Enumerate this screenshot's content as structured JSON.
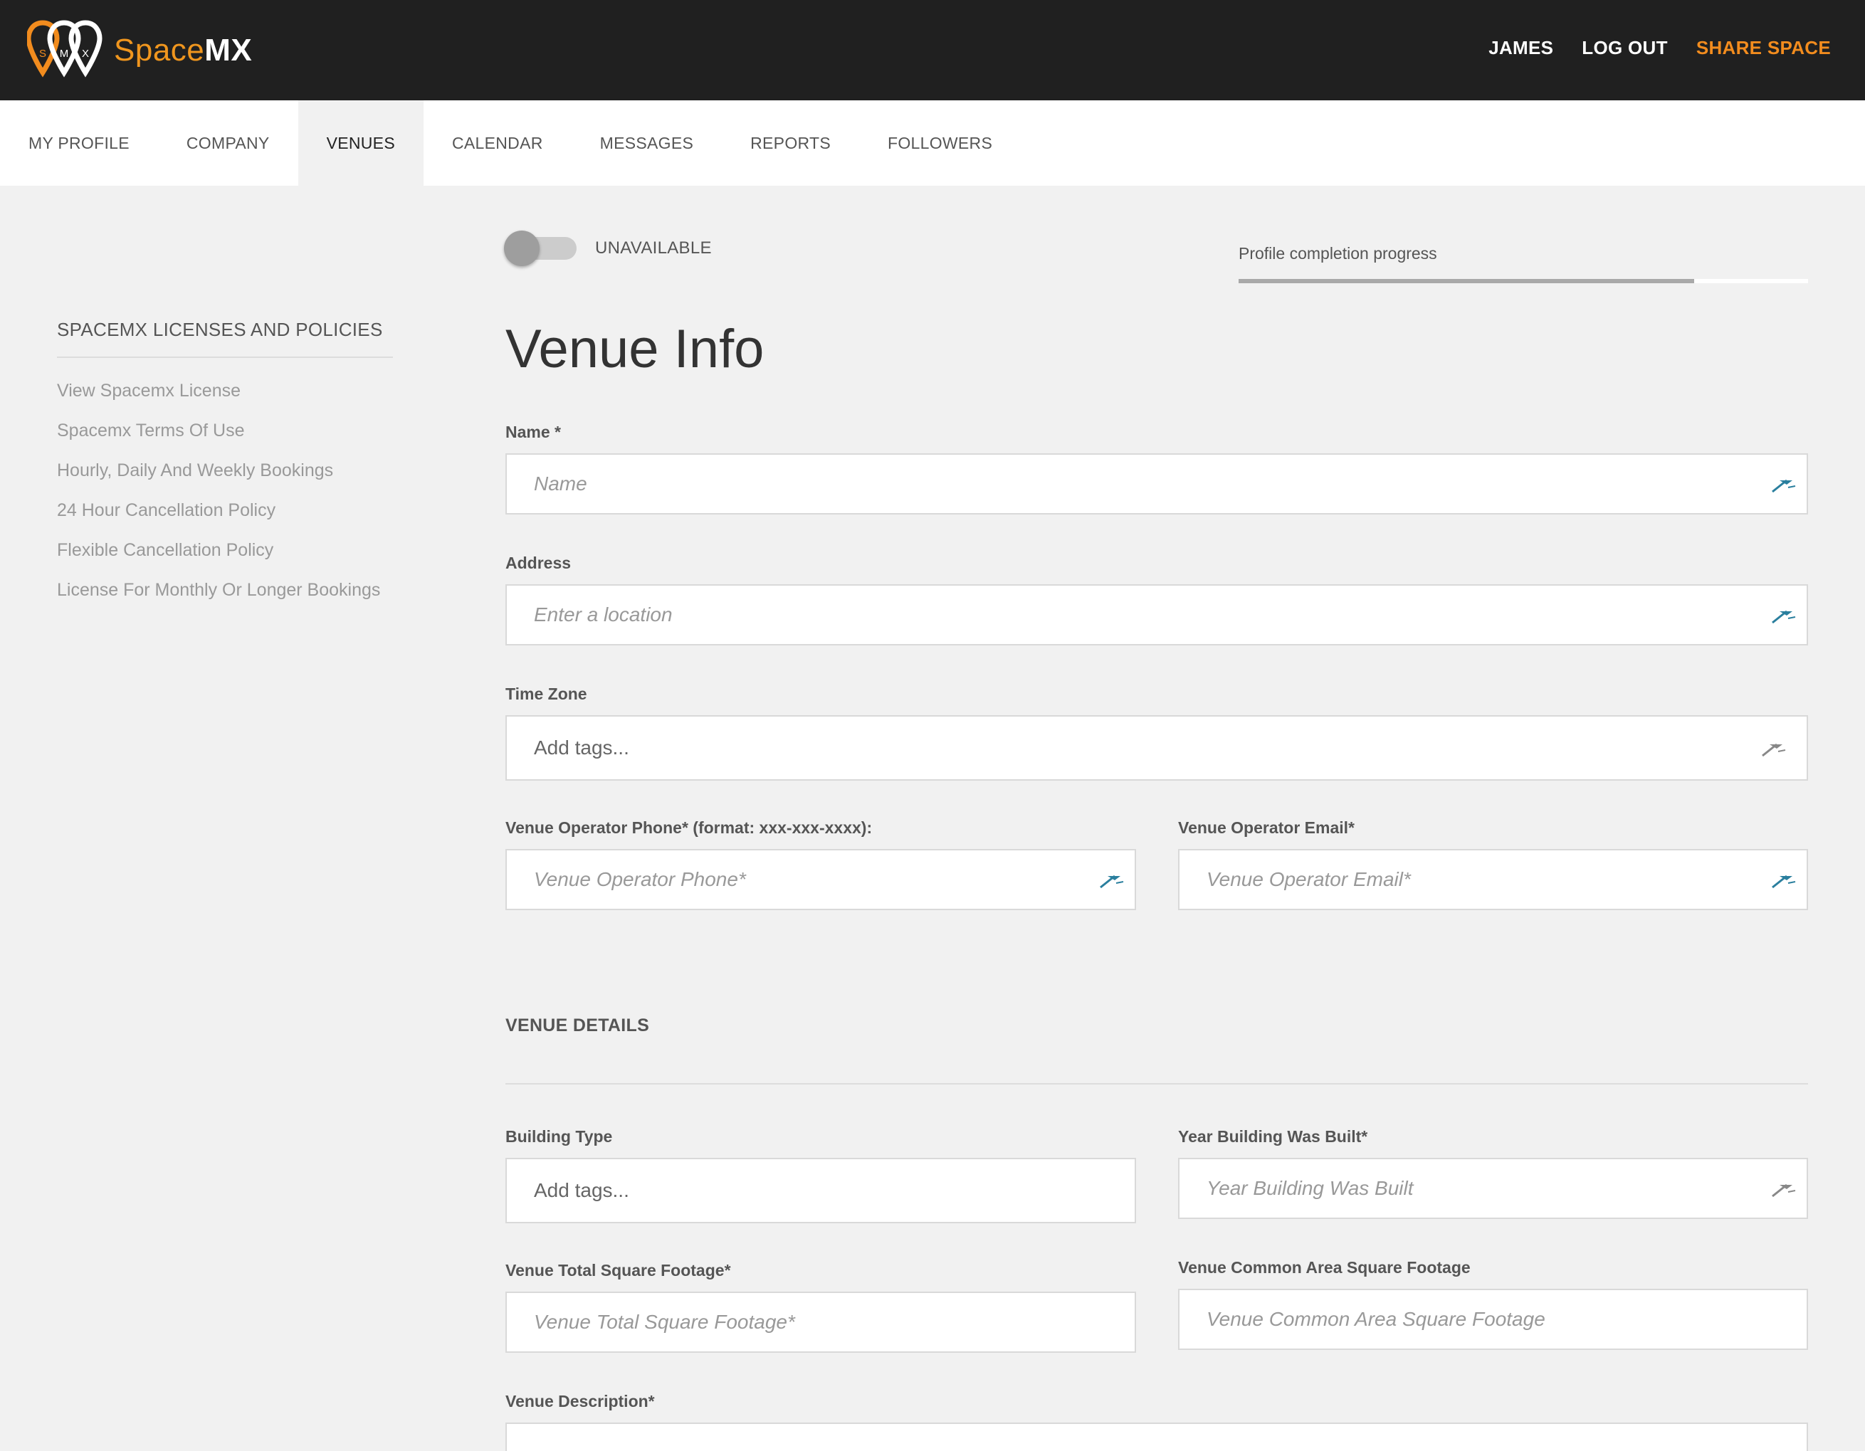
{
  "brand": {
    "space": "Space",
    "mx": "MX",
    "logo_letters": [
      "S",
      "M",
      "X"
    ],
    "accent_color": "#f28c1e"
  },
  "top_nav": {
    "user": "JAMES",
    "logout": "LOG OUT",
    "share": "SHARE SPACE"
  },
  "tabs": [
    {
      "label": "MY PROFILE",
      "active": false
    },
    {
      "label": "COMPANY",
      "active": false
    },
    {
      "label": "VENUES",
      "active": true
    },
    {
      "label": "CALENDAR",
      "active": false
    },
    {
      "label": "MESSAGES",
      "active": false
    },
    {
      "label": "REPORTS",
      "active": false
    },
    {
      "label": "FOLLOWERS",
      "active": false
    }
  ],
  "sidebar": {
    "title": "SPACEMX LICENSES AND POLICIES",
    "links": [
      "View Spacemx License",
      "Spacemx Terms Of Use",
      "Hourly, Daily And Weekly Bookings",
      "24 Hour Cancellation Policy",
      "Flexible Cancellation Policy",
      "License For Monthly Or Longer Bookings"
    ]
  },
  "availability": {
    "label": "UNAVAILABLE",
    "on": false
  },
  "progress": {
    "label": "Profile completion progress",
    "fraction": 0.8
  },
  "page_title": "Venue Info",
  "form": {
    "name": {
      "label": "Name *",
      "placeholder": "Name",
      "value": ""
    },
    "address": {
      "label": "Address",
      "placeholder": "Enter a location",
      "value": ""
    },
    "time_zone": {
      "label": "Time Zone",
      "placeholder": "Add tags...",
      "value": ""
    },
    "phone": {
      "label": "Venue Operator Phone* (format: xxx-xxx-xxxx):",
      "placeholder": "Venue Operator Phone*",
      "value": ""
    },
    "email": {
      "label": "Venue Operator Email*",
      "placeholder": "Venue Operator Email*",
      "value": ""
    }
  },
  "details": {
    "title": "VENUE DETAILS",
    "building_type": {
      "label": "Building Type",
      "placeholder": "Add tags...",
      "value": ""
    },
    "year_built": {
      "label": "Year Building Was Built*",
      "placeholder": "Year Building Was Built",
      "value": ""
    },
    "total_sqft": {
      "label": "Venue Total Square Footage*",
      "placeholder": "Venue Total Square Footage*",
      "value": ""
    },
    "common_sqft": {
      "label": "Venue Common Area Square Footage",
      "placeholder": "Venue Common Area Square Footage",
      "value": ""
    },
    "description": {
      "label": "Venue Description*"
    }
  }
}
